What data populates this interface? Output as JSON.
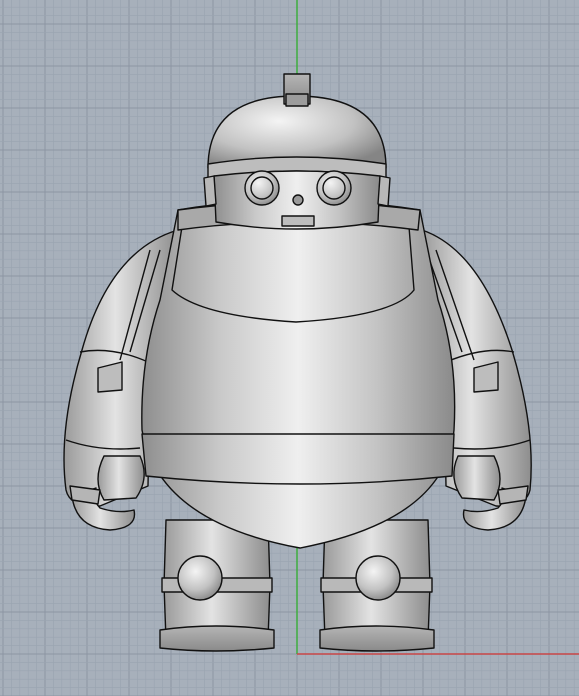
{
  "viewport": {
    "view": "Front",
    "display_mode": "Shaded",
    "background_color": "#a7b0bb",
    "grid_minor_color": "#9aa4b0",
    "grid_major_color": "#8c96a3",
    "axis_y_color": "#3fae3f",
    "axis_x_color": "#c84646",
    "object_outline_color": "#111111",
    "model": {
      "name": "robot",
      "parts": [
        "helmet",
        "visor",
        "eyes",
        "torso",
        "belt",
        "arms",
        "hands",
        "legs",
        "knees",
        "feet"
      ]
    }
  }
}
